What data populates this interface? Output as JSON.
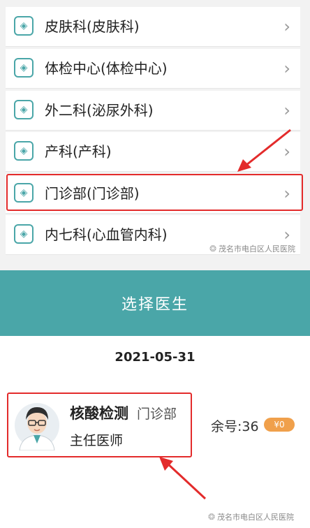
{
  "departments": [
    {
      "label": "皮肤科(皮肤科)"
    },
    {
      "label": "体检中心(体检中心)"
    },
    {
      "label": "外二科(泌尿外科)"
    },
    {
      "label": "产科(产科)"
    },
    {
      "label": "门诊部(门诊部)"
    },
    {
      "label": "内七科(心血管内科)"
    }
  ],
  "icons": {
    "department": "plus-diamond-icon",
    "chevron": "chevron-right-icon",
    "watermark": "chat-icon",
    "avatar": "doctor-avatar"
  },
  "chevron_glyph": "›",
  "watermark_text": "茂名市电白区人民医院",
  "select_bar": {
    "label": "选择医生"
  },
  "schedule": {
    "date": "2021-05-31"
  },
  "doctor": {
    "name": "核酸检测",
    "department": "门诊部",
    "title": "主任医师",
    "remaining_label": "余号:36",
    "price": "¥0"
  },
  "colors": {
    "accent": "#4aa6a8",
    "highlight": "#e32b2b",
    "price_badge": "#f0a04b"
  }
}
